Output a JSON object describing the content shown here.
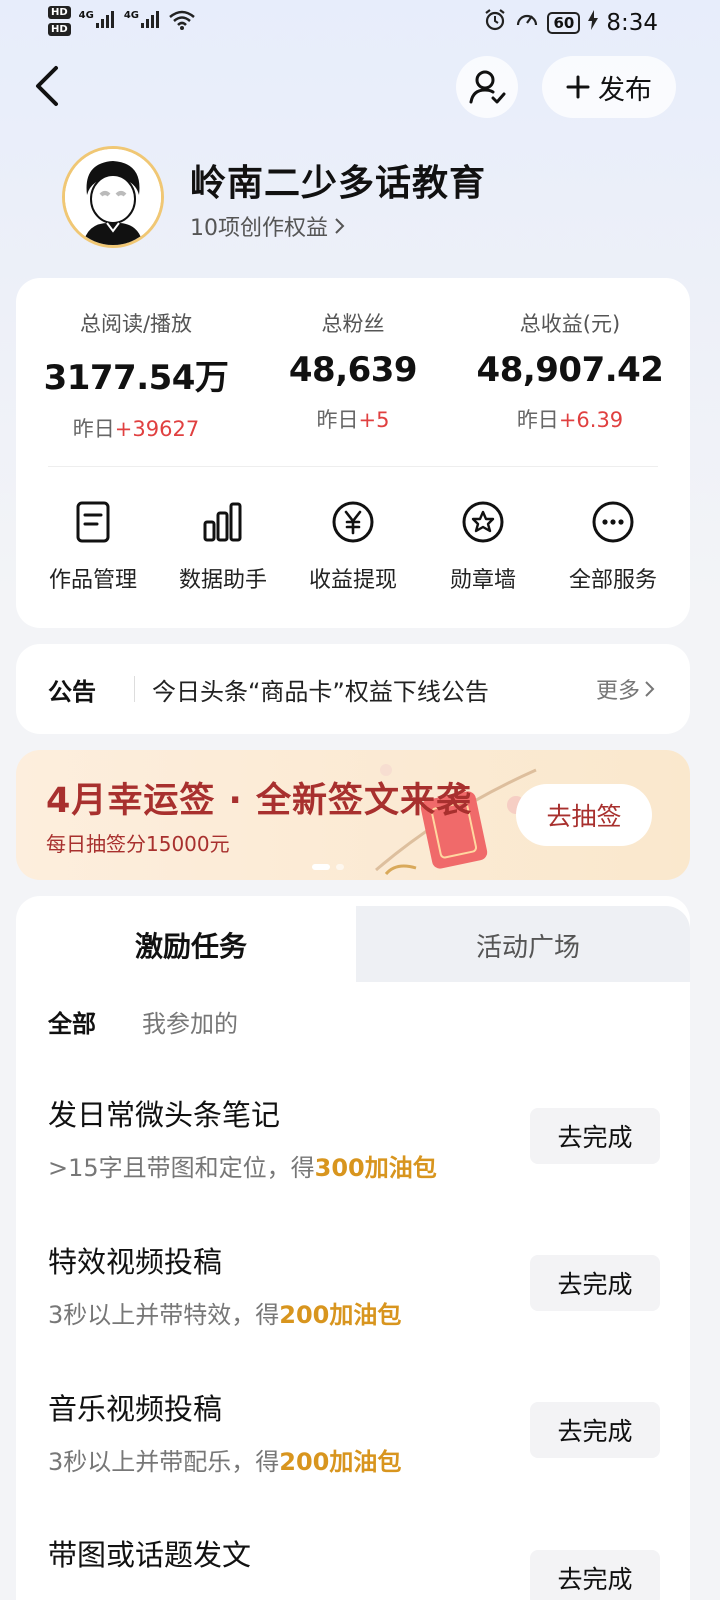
{
  "status_bar": {
    "hd1": "HD",
    "hd2": "HD",
    "net1": "4G",
    "net2": "4G",
    "battery": "60",
    "time": "8:34"
  },
  "header": {
    "publish_label": "发布"
  },
  "profile": {
    "name": "岭南二少多话教育",
    "rights": "10项创作权益"
  },
  "stats": [
    {
      "label": "总阅读/播放",
      "value": "3177.54万",
      "delta_prefix": "昨日",
      "delta": "+39627"
    },
    {
      "label": "总粉丝",
      "value": "48,639",
      "delta_prefix": "昨日",
      "delta": "+5"
    },
    {
      "label": "总收益(元)",
      "value": "48,907.42",
      "delta_prefix": "昨日",
      "delta": "+6.39"
    }
  ],
  "services": [
    {
      "label": "作品管理",
      "icon": "document-icon"
    },
    {
      "label": "数据助手",
      "icon": "bar-chart-icon"
    },
    {
      "label": "收益提现",
      "icon": "yuan-icon"
    },
    {
      "label": "勋章墙",
      "icon": "medal-icon"
    },
    {
      "label": "全部服务",
      "icon": "more-icon"
    }
  ],
  "notice": {
    "tag": "公告",
    "text": "今日头条“商品卡”权益下线公告",
    "more": "更多"
  },
  "banner": {
    "title": "4月幸运签 · 全新签文来袭",
    "subtitle": "每日抽签分15000元",
    "button": "去抽签"
  },
  "tabs": {
    "active": "激励任务",
    "other": "活动广场"
  },
  "filters": {
    "all": "全部",
    "mine": "我参加的"
  },
  "tasks": [
    {
      "title": "发日常微头条笔记",
      "desc": ">15字且带图和定位，得",
      "reward": "300加油包",
      "button": "去完成"
    },
    {
      "title": "特效视频投稿",
      "desc": "3秒以上并带特效，得",
      "reward": "200加油包",
      "button": "去完成"
    },
    {
      "title": "音乐视频投稿",
      "desc": "3秒以上并带配乐，得",
      "reward": "200加油包",
      "button": "去完成"
    },
    {
      "title": "带图或话题发文",
      "desc": "",
      "reward": "",
      "button": "去完成"
    }
  ],
  "colors": {
    "accent_red": "#e04040",
    "reward_gold": "#d8951e",
    "banner_red": "#a8302e"
  }
}
